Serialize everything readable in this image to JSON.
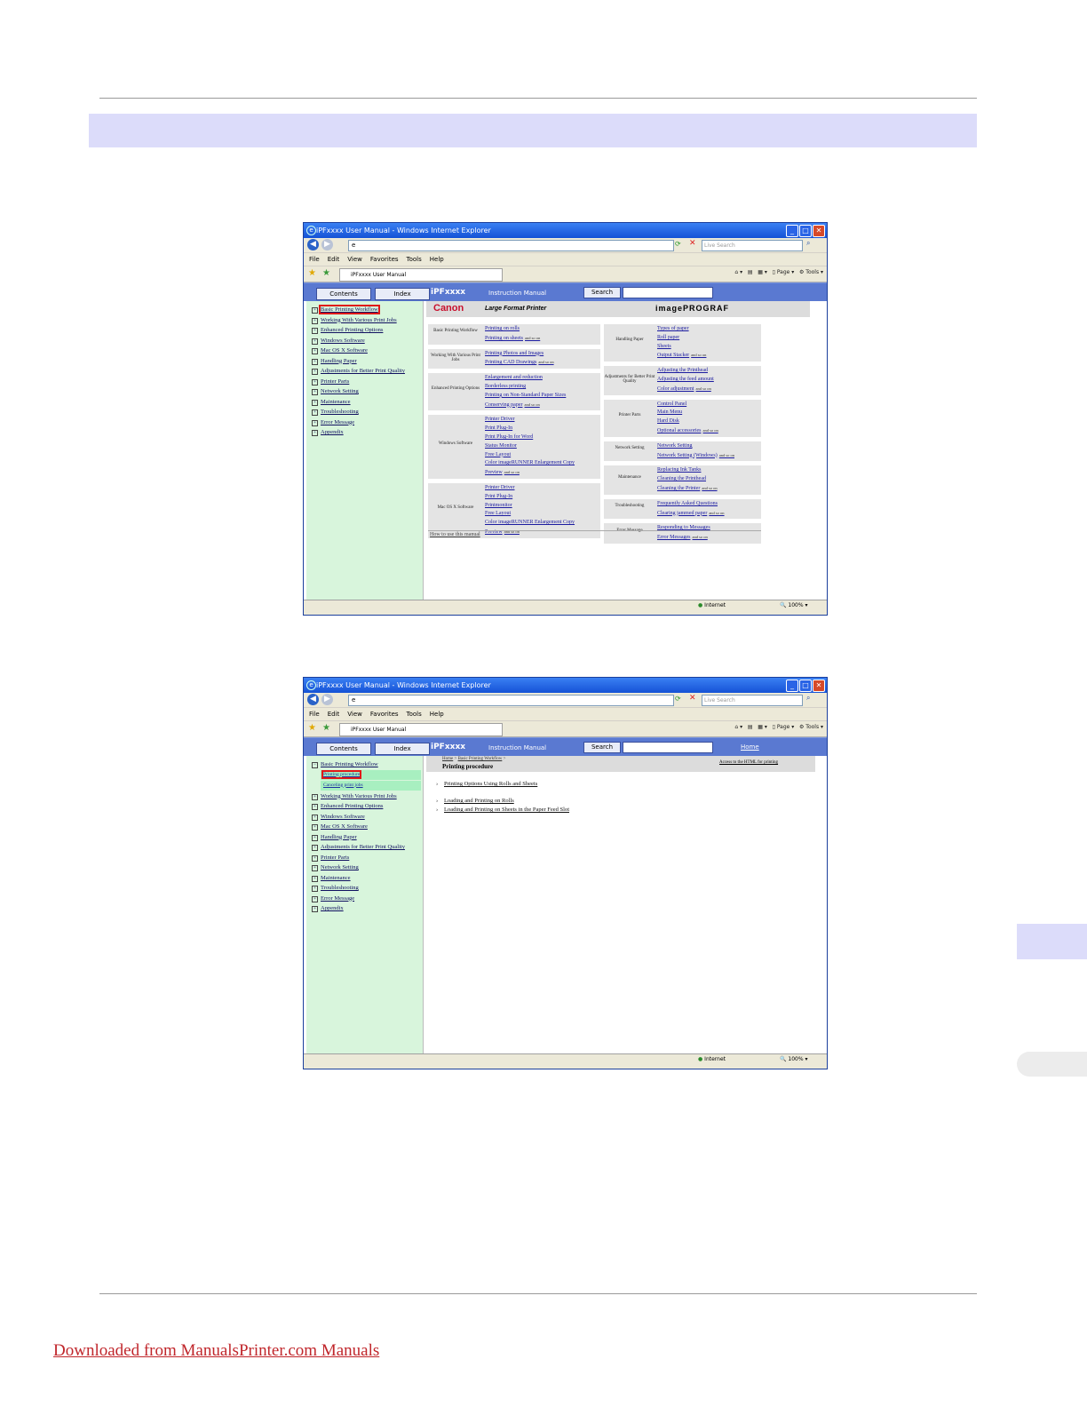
{
  "footer": {
    "link": "Downloaded from ManualsPrinter.com Manuals"
  },
  "browser": {
    "title": "iPFxxxx User Manual - Windows Internet Explorer",
    "live_search": "Live Search",
    "menu": [
      "File",
      "Edit",
      "View",
      "Favorites",
      "Tools",
      "Help"
    ],
    "tab_title": "iPFxxxx User Manual",
    "page_label": "Page",
    "tools_label": "Tools",
    "status_zone": "Internet",
    "zoom": "100%"
  },
  "manual": {
    "contents_tab": "Contents",
    "index_tab": "Index",
    "title": "iPFxxxx",
    "subtitle": "Instruction Manual",
    "search_button": "Search",
    "home_link": "Home"
  },
  "sidebar": {
    "items": [
      "Basic Printing Workflow",
      "Working With Various Print Jobs",
      "Enhanced Printing Options",
      "Windows Software",
      "Mac OS X Software",
      "Handling Paper",
      "Adjustments for Better Print Quality",
      "Printer Parts",
      "Network Setting",
      "Maintenance",
      "Troubleshooting",
      "Error Message",
      "Appendix"
    ],
    "subitems": [
      "Printing procedure",
      "Canceling print jobs"
    ]
  },
  "home": {
    "brand": "Canon",
    "tagline": "Large Format Printer",
    "product": "imagePROGRAF",
    "and_so_on": "and so on",
    "how_to": "How to use this manual",
    "left_categories": [
      {
        "label": "Basic Printing Workflow",
        "links": [
          "Printing on rolls",
          "Printing on sheets"
        ]
      },
      {
        "label": "Working With Various Print Jobs",
        "links": [
          "Printing Photos and Images",
          "Printing CAD Drawings"
        ]
      },
      {
        "label": "Enhanced Printing Options",
        "links": [
          "Enlargement and reduction",
          "Borderless printing",
          "Printing on Non-Standard Paper Sizes",
          "Conserving paper"
        ]
      },
      {
        "label": "Windows Software",
        "links": [
          "Printer Driver",
          "Print Plug-In",
          "Print Plug-In for Word",
          "Status Monitor",
          "Free Layout",
          "Color imageRUNNER Enlargement Copy",
          "Preview"
        ]
      },
      {
        "label": "Mac OS X Software",
        "links": [
          "Printer Driver",
          "Print Plug-In",
          "Printmonitor",
          "Free Layout",
          "Color imageRUNNER Enlargement Copy",
          "Preview"
        ]
      }
    ],
    "right_categories": [
      {
        "label": "Handling Paper",
        "links": [
          "Types of paper",
          "Roll paper",
          "Sheets",
          "Output Stacker"
        ]
      },
      {
        "label": "Adjustments for Better Print Quality",
        "links": [
          "Adjusting the Printhead",
          "Adjusting the feed amount",
          "Color adjustment"
        ]
      },
      {
        "label": "Printer Parts",
        "links": [
          "Control Panel",
          "Main Menu",
          "Hard Disk",
          "Optional accessories"
        ]
      },
      {
        "label": "Network Setting",
        "links": [
          "Network Setting",
          "Network Setting (Windows)"
        ]
      },
      {
        "label": "Maintenance",
        "links": [
          "Replacing Ink Tanks",
          "Cleaning the Printhead",
          "Cleaning the Printer"
        ]
      },
      {
        "label": "Troubleshooting",
        "links": [
          "Frequently Asked Questions",
          "Clearing jammed paper"
        ]
      },
      {
        "label": "Error Message",
        "links": [
          "Responding to Messages",
          "Error Messages"
        ]
      }
    ]
  },
  "procedure": {
    "crumb_home": "Home",
    "crumb_sep": ">",
    "crumb_parent": "Basic Printing Workflow",
    "title": "Printing procedure",
    "access": "Access to the HTML for printing",
    "links": [
      "Printing Options Using Rolls and Sheets",
      "Loading and Printing on Rolls",
      "Loading and Printing on Sheets in the Paper Feed Slot"
    ]
  }
}
